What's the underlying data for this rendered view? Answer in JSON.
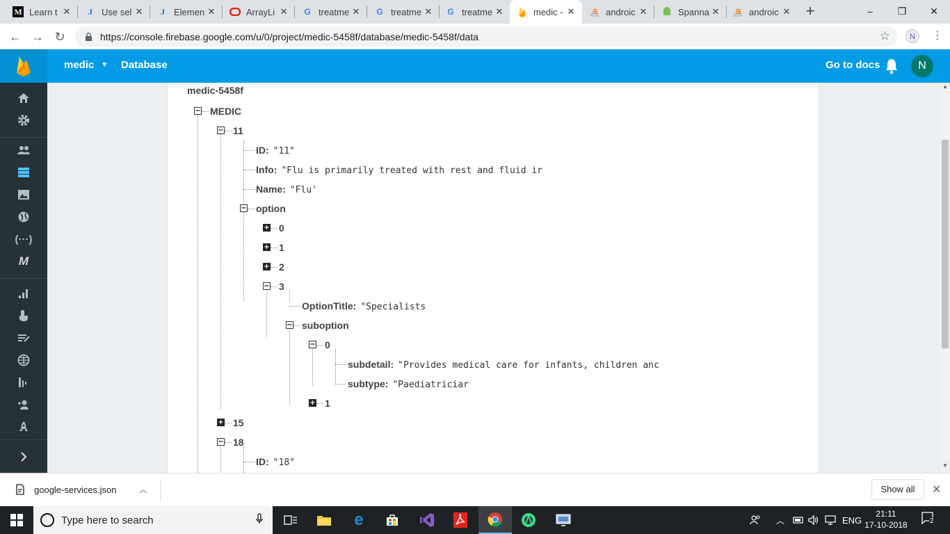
{
  "browser": {
    "tabs": [
      {
        "favicon": "M",
        "title": "Learn t",
        "active": false
      },
      {
        "favicon": "J",
        "title": "Use sel",
        "active": false
      },
      {
        "favicon": "J",
        "title": "Elemen",
        "active": false
      },
      {
        "favicon": "oracle",
        "title": "ArrayLi",
        "active": false
      },
      {
        "favicon": "G",
        "title": "treatme",
        "active": false
      },
      {
        "favicon": "G",
        "title": "treatme",
        "active": false
      },
      {
        "favicon": "G",
        "title": "treatme",
        "active": false
      },
      {
        "favicon": "firebase",
        "title": "medic - ",
        "active": true
      },
      {
        "favicon": "stackoverflow",
        "title": "androic",
        "active": false
      },
      {
        "favicon": "android",
        "title": "Spanna",
        "active": false
      },
      {
        "favicon": "stackoverflow",
        "title": "androic",
        "active": false
      }
    ],
    "new_tab": "+",
    "window_controls": {
      "minimize": "–",
      "maximize": "❐",
      "close": "✕"
    },
    "url": "https://console.firebase.google.com/u/0/project/medic-5458f/database/medic-5458f/data",
    "profile_initial": "N"
  },
  "firebase": {
    "project_name": "medic",
    "section": "Database",
    "go_to_docs": "Go to docs",
    "avatar_initial": "N",
    "brand_color": "#039be5",
    "rail_bg": "#263238"
  },
  "rail": {
    "items": [
      {
        "icon": "home-icon"
      },
      {
        "icon": "settings-icon"
      },
      {
        "icon": "authentication-icon"
      },
      {
        "icon": "database-icon",
        "active": true
      },
      {
        "icon": "storage-icon"
      },
      {
        "icon": "hosting-icon"
      },
      {
        "icon": "functions-icon"
      },
      {
        "icon": "ml-kit-icon"
      },
      {
        "icon": "analytics-icon"
      },
      {
        "icon": "test-lab-icon"
      },
      {
        "icon": "predictions-icon"
      },
      {
        "icon": "grow-icon"
      },
      {
        "icon": "ab-testing-icon"
      },
      {
        "icon": "invites-icon"
      },
      {
        "icon": "launch-icon"
      }
    ]
  },
  "tree": {
    "root": "medic-5458f",
    "nodes": {
      "medic": "MEDIC",
      "n11": "11",
      "id_key": "ID:",
      "id_val": "\"11\"",
      "info_key": "Info:",
      "info_val": "\"Flu is primarily treated with rest and fluid ir",
      "name_key": "Name:",
      "name_val": "\"Flu'",
      "option": "option",
      "opt0": "0",
      "opt1": "1",
      "opt2": "2",
      "opt3": "3",
      "optiontitle_key": "OptionTitle:",
      "optiontitle_val": "\"Specialists",
      "suboption": "suboption",
      "sub0": "0",
      "subdetail_key": "subdetail:",
      "subdetail_val": "\"Provides medical care for infants, children anc",
      "subtype_key": "subtype:",
      "subtype_val": "\"Paediatriciar",
      "sub1": "1",
      "n15": "15",
      "n18": "18",
      "id18_key": "ID:",
      "id18_val": "\"18\""
    }
  },
  "download_shelf": {
    "file": "google-services.json",
    "show_all": "Show all"
  },
  "taskbar": {
    "search_placeholder": "Type here to search",
    "language": "ENG",
    "time": "21:11",
    "date": "17-10-2018",
    "notifications": "2"
  }
}
